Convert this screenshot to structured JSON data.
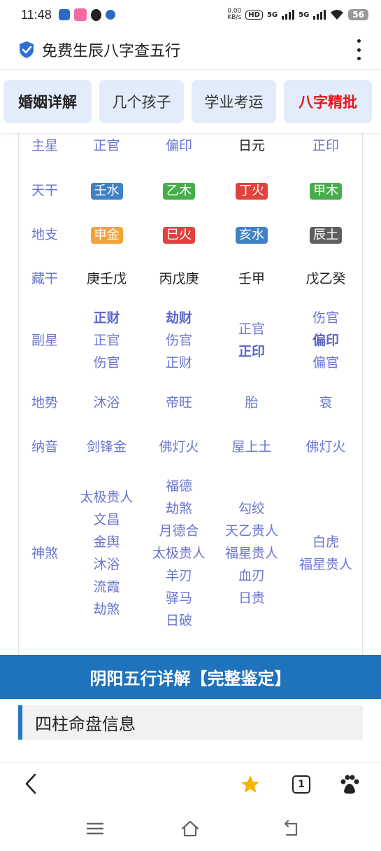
{
  "status": {
    "time": "11:48",
    "net_speed_top": "0.00",
    "net_speed_unit": "KB/s",
    "hd": "HD",
    "sig1": "5G",
    "sig2": "5G",
    "battery": "56"
  },
  "titlebar": {
    "title": "免费生辰八字查五行"
  },
  "tabs": [
    "婚姻详解",
    "几个孩子",
    "学业考运",
    "八字精批"
  ],
  "table": {
    "zhuxing": {
      "label": "主星",
      "values": [
        "正官",
        "偏印",
        "日元",
        "正印"
      ]
    },
    "tiangan": {
      "label": "天干",
      "values": [
        "壬水",
        "乙木",
        "丁火",
        "甲木"
      ]
    },
    "dizhi": {
      "label": "地支",
      "values": [
        "申金",
        "巳火",
        "亥水",
        "辰土"
      ]
    },
    "canggan": {
      "label": "藏干",
      "values": [
        "庚壬戊",
        "丙戊庚",
        "壬甲",
        "戊乙癸"
      ]
    },
    "fuxing": {
      "label": "副星",
      "col1": [
        "正财",
        "正官",
        "伤官"
      ],
      "col2": [
        "劫财",
        "伤官",
        "正财"
      ],
      "col3": [
        "正官",
        "正印"
      ],
      "col4": [
        "伤官",
        "偏印",
        "偏官"
      ]
    },
    "dishi": {
      "label": "地势",
      "values": [
        "沐浴",
        "帝旺",
        "胎",
        "衰"
      ]
    },
    "nayin": {
      "label": "纳音",
      "values": [
        "剑锋金",
        "佛灯火",
        "屋上土",
        "佛灯火"
      ]
    },
    "shensha": {
      "label": "神煞",
      "col1": [
        "太极贵人",
        "文昌",
        "金舆",
        "沐浴",
        "流霞",
        "劫煞"
      ],
      "col2": [
        "福德",
        "劫煞",
        "月德合",
        "太极贵人",
        "羊刃",
        "驿马",
        "日破"
      ],
      "col3": [
        "勾绞",
        "天乙贵人",
        "福星贵人",
        "血刃",
        "日贵"
      ],
      "col4": [
        "白虎",
        "福星贵人"
      ]
    }
  },
  "colors": {
    "water": "#3f82c6",
    "wood": "#47ad4b",
    "fire": "#e0423c",
    "metal": "#f0a43a",
    "earth": "#5f5f5f",
    "accent": "#1f72bc"
  },
  "banner": {
    "text": "阴阳五行详解【完整鉴定】"
  },
  "section": {
    "title": "四柱命盘信息"
  },
  "browser": {
    "tab_count": "1"
  }
}
